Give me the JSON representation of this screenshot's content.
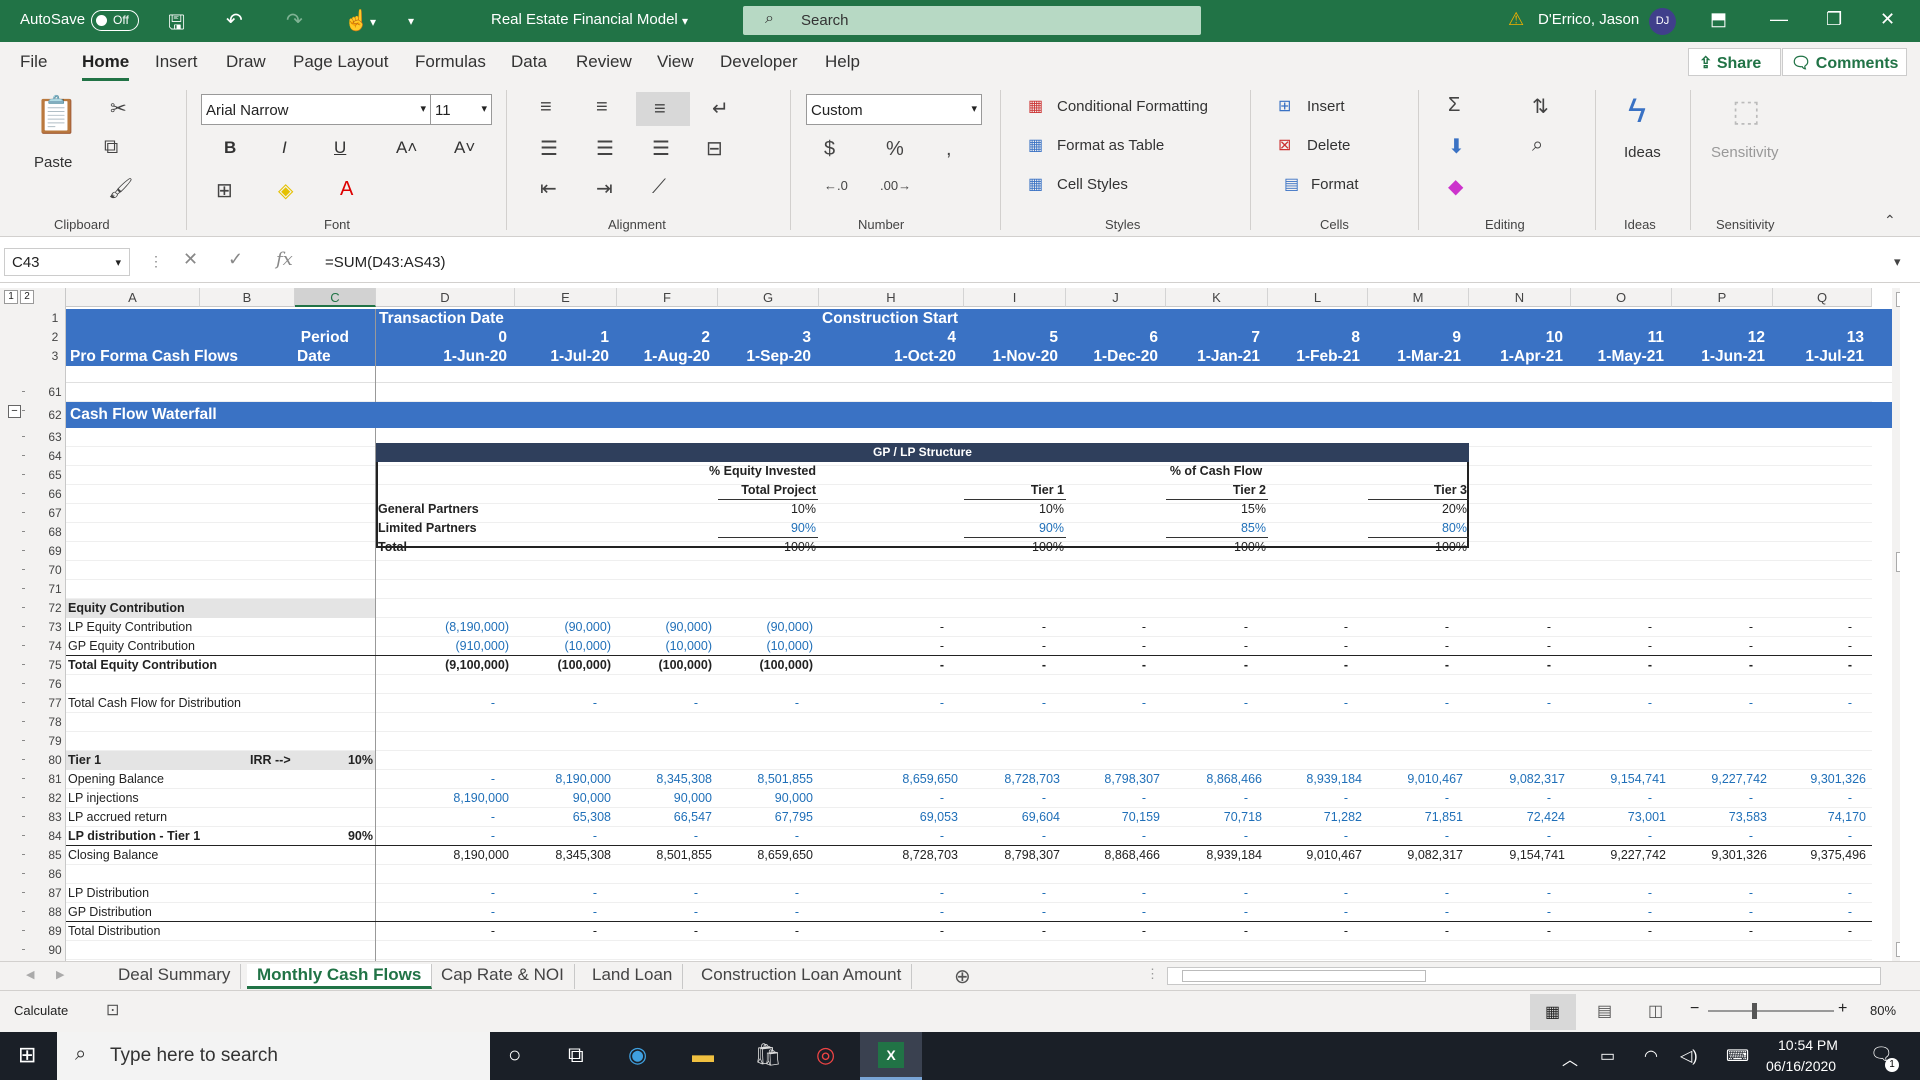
{
  "titlebar": {
    "autosave_label": "AutoSave",
    "autosave_state": "Off",
    "document_title": "Real Estate Financial Model",
    "search_placeholder": "Search",
    "user_name": "D'Errico, Jason",
    "user_initials": "DJ"
  },
  "menu": {
    "tabs": [
      "File",
      "Home",
      "Insert",
      "Draw",
      "Page Layout",
      "Formulas",
      "Data",
      "Review",
      "View",
      "Developer",
      "Help"
    ],
    "active": "Home",
    "share_label": "Share",
    "comments_label": "Comments"
  },
  "ribbon": {
    "clipboard": {
      "paste": "Paste",
      "label": "Clipboard"
    },
    "font": {
      "name": "Arial Narrow",
      "size": "11",
      "label": "Font"
    },
    "alignment": {
      "label": "Alignment"
    },
    "number": {
      "format": "Custom",
      "label": "Number"
    },
    "styles": {
      "conditional": "Conditional Formatting",
      "table": "Format as Table",
      "cellstyles": "Cell Styles",
      "label": "Styles"
    },
    "cells": {
      "insert": "Insert",
      "delete": "Delete",
      "format": "Format",
      "label": "Cells"
    },
    "editing": {
      "label": "Editing"
    },
    "ideas": {
      "button": "Ideas",
      "label": "Ideas"
    },
    "sensitivity": {
      "button": "Sensitivity",
      "label": "Sensitivity"
    }
  },
  "formula_bar": {
    "name_box": "C43",
    "formula": "=SUM(D43:AS43)"
  },
  "columns": [
    "A",
    "B",
    "C",
    "D",
    "E",
    "F",
    "G",
    "H",
    "I",
    "J",
    "K",
    "L",
    "M",
    "N",
    "O",
    "P",
    "Q"
  ],
  "header": {
    "row1": {
      "D": "Transaction Date",
      "H": "Construction Start"
    },
    "row2_b": "Period",
    "row3_a": "Pro Forma Cash Flows",
    "row3_b": "Date",
    "periods": [
      "0",
      "1",
      "2",
      "3",
      "4",
      "5",
      "6",
      "7",
      "8",
      "9",
      "10",
      "11",
      "12",
      "13"
    ],
    "dates": [
      "1-Jun-20",
      "1-Jul-20",
      "1-Aug-20",
      "1-Sep-20",
      "1-Oct-20",
      "1-Nov-20",
      "1-Dec-20",
      "1-Jan-21",
      "1-Feb-21",
      "1-Mar-21",
      "1-Apr-21",
      "1-May-21",
      "1-Jun-21",
      "1-Jul-21"
    ]
  },
  "section_title": "Cash Flow Waterfall",
  "gplp": {
    "title": "GP / LP Structure",
    "equity_header": "% Equity Invested",
    "total_project": "Total Project",
    "cashflow_header": "% of Cash Flow",
    "tiers": [
      "Tier 1",
      "Tier 2",
      "Tier 3"
    ],
    "rows": [
      {
        "label": "General Partners",
        "equity": "10%",
        "tiers": [
          "10%",
          "15%",
          "20%"
        ]
      },
      {
        "label": "Limited Partners",
        "equity": "90%",
        "tiers": [
          "90%",
          "85%",
          "80%"
        ]
      },
      {
        "label": "Total",
        "equity": "100%",
        "tiers": [
          "100%",
          "100%",
          "100%"
        ]
      }
    ]
  },
  "rows": {
    "equity_contribution": "Equity Contribution",
    "lp_equity": {
      "label": "LP Equity Contribution",
      "values": [
        "(8,190,000)",
        "(90,000)",
        "(90,000)",
        "(90,000)",
        "-",
        "-",
        "-",
        "-",
        "-",
        "-",
        "-",
        "-",
        "-",
        "-"
      ]
    },
    "gp_equity": {
      "label": "GP Equity Contribution",
      "values": [
        "(910,000)",
        "(10,000)",
        "(10,000)",
        "(10,000)",
        "-",
        "-",
        "-",
        "-",
        "-",
        "-",
        "-",
        "-",
        "-",
        "-"
      ]
    },
    "total_equity": {
      "label": "Total Equity Contribution",
      "values": [
        "(9,100,000)",
        "(100,000)",
        "(100,000)",
        "(100,000)",
        "-",
        "-",
        "-",
        "-",
        "-",
        "-",
        "-",
        "-",
        "-",
        "-"
      ]
    },
    "total_cf": {
      "label": "Total Cash Flow for Distribution",
      "values": [
        "-",
        "-",
        "-",
        "-",
        "-",
        "-",
        "-",
        "-",
        "-",
        "-",
        "-",
        "-",
        "-",
        "-"
      ]
    },
    "tier1": {
      "label": "Tier 1",
      "irr_label": "IRR -->",
      "irr": "10%"
    },
    "opening": {
      "label": "Opening Balance",
      "values": [
        "-",
        "8,190,000",
        "8,345,308",
        "8,501,855",
        "8,659,650",
        "8,728,703",
        "8,798,307",
        "8,868,466",
        "8,939,184",
        "9,010,467",
        "9,082,317",
        "9,154,741",
        "9,227,742",
        "9,301,326"
      ]
    },
    "lp_inj": {
      "label": "LP injections",
      "values": [
        "8,190,000",
        "90,000",
        "90,000",
        "90,000",
        "-",
        "-",
        "-",
        "-",
        "-",
        "-",
        "-",
        "-",
        "-",
        "-"
      ]
    },
    "lp_accr": {
      "label": "LP accrued return",
      "values": [
        "-",
        "65,308",
        "66,547",
        "67,795",
        "69,053",
        "69,604",
        "70,159",
        "70,718",
        "71,282",
        "71,851",
        "72,424",
        "73,001",
        "73,583",
        "74,170"
      ]
    },
    "lp_dist_t1": {
      "label": "LP distribution - Tier 1",
      "pct": "90%",
      "values": [
        "-",
        "-",
        "-",
        "-",
        "-",
        "-",
        "-",
        "-",
        "-",
        "-",
        "-",
        "-",
        "-",
        "-"
      ]
    },
    "closing": {
      "label": "Closing Balance",
      "values": [
        "8,190,000",
        "8,345,308",
        "8,501,855",
        "8,659,650",
        "8,728,703",
        "8,798,307",
        "8,868,466",
        "8,939,184",
        "9,010,467",
        "9,082,317",
        "9,154,741",
        "9,227,742",
        "9,301,326",
        "9,375,496"
      ]
    },
    "lp_dist": {
      "label": "LP Distribution",
      "values": [
        "-",
        "-",
        "-",
        "-",
        "-",
        "-",
        "-",
        "-",
        "-",
        "-",
        "-",
        "-",
        "-",
        "-"
      ]
    },
    "gp_dist": {
      "label": "GP Distribution",
      "values": [
        "-",
        "-",
        "-",
        "-",
        "-",
        "-",
        "-",
        "-",
        "-",
        "-",
        "-",
        "-",
        "-",
        "-"
      ]
    },
    "total_dist": {
      "label": "Total Distribution",
      "values": [
        "-",
        "-",
        "-",
        "-",
        "-",
        "-",
        "-",
        "-",
        "-",
        "-",
        "-",
        "-",
        "-",
        "-"
      ]
    }
  },
  "row_numbers": [
    "1",
    "2",
    "3",
    "61",
    "62",
    "63",
    "64",
    "65",
    "66",
    "67",
    "68",
    "69",
    "70",
    "71",
    "72",
    "73",
    "74",
    "75",
    "76",
    "77",
    "78",
    "79",
    "80",
    "81",
    "82",
    "83",
    "84",
    "85",
    "86",
    "87",
    "88",
    "89",
    "90"
  ],
  "sheets": [
    "Deal Summary",
    "Monthly Cash Flows",
    "Cap Rate & NOI",
    "Land Loan",
    "Construction Loan Amount"
  ],
  "active_sheet": "Monthly Cash Flows",
  "status": {
    "mode": "Calculate",
    "zoom": "80%"
  },
  "taskbar": {
    "search_placeholder": "Type here to search",
    "time": "10:54 PM",
    "date": "06/16/2020",
    "notif_count": "1"
  },
  "colors": {
    "excel_green": "#217346",
    "header_blue": "#3a72c4",
    "dark_header": "#2f3f5c",
    "input_blue": "#1f6fb8"
  }
}
